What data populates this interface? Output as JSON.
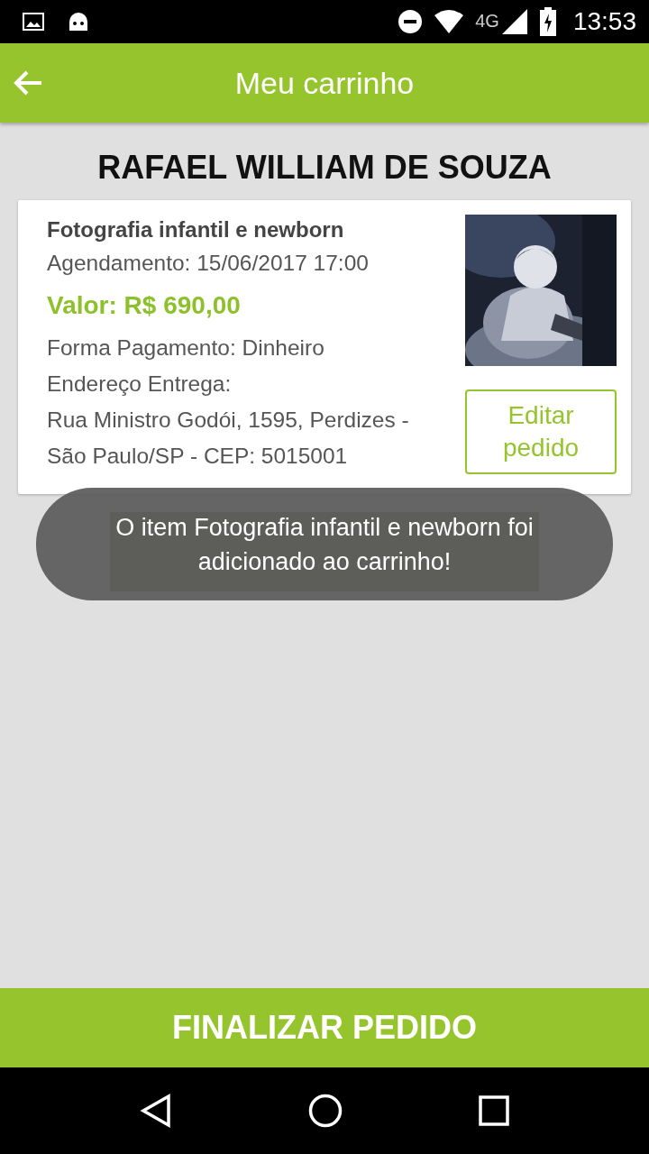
{
  "status_bar": {
    "network": "4G",
    "time": "13:53"
  },
  "app_bar": {
    "title": "Meu carrinho"
  },
  "customer_name": "RAFAEL WILLIAM DE SOUZA",
  "items": [
    {
      "title": "Fotografia infantil e newborn",
      "schedule": "Agendamento: 15/06/2017 17:00",
      "price": "Valor: R$ 690,00",
      "payment": "Forma Pagamento: Dinheiro",
      "address_label": "Endereço Entrega:",
      "address": "Rua Ministro Godói, 1595, Perdizes - São Paulo/SP - CEP: 5015001",
      "edit_button": "Editar pedido"
    }
  ],
  "toast": "O item Fotografia infantil e newborn foi adicionado ao carrinho!",
  "finish_button": "FINALIZAR PEDIDO"
}
